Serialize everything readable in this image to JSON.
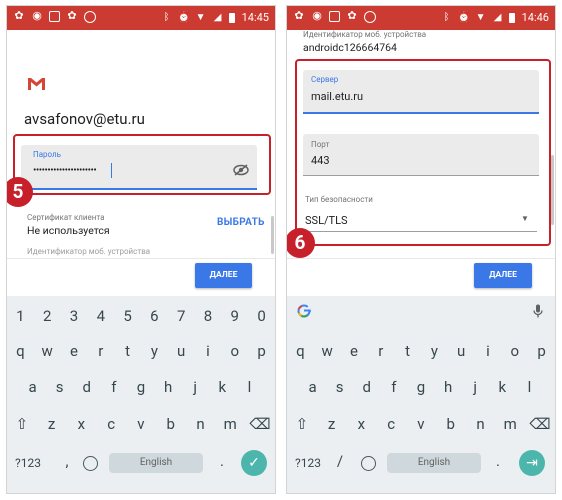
{
  "status_bar": {
    "time": "14:45"
  },
  "left_screen": {
    "account_email": "avsafonov@etu.ru",
    "password_field": {
      "label": "Пароль",
      "value": "••••••••••••••••••••••"
    },
    "client_certificate": {
      "label": "Сертификат клиента",
      "value": "Не используется",
      "action": "ВЫБРАТЬ"
    },
    "device_id_label_partial": "Идентификатор моб. устройства",
    "next_button": "ДАЛЕЕ",
    "step_badge": "5"
  },
  "right_screen": {
    "status_time": "14:46",
    "device_id": {
      "label": "Идентификатор моб. устройства",
      "value": "androidc126664764"
    },
    "server_field": {
      "label": "Сервер",
      "value": "mail.etu.ru"
    },
    "port_field": {
      "label": "Порт",
      "value": "443"
    },
    "security_field": {
      "label": "Тип безопасности",
      "value": "SSL/TLS"
    },
    "next_button": "ДАЛЕЕ",
    "step_badge": "6"
  },
  "keyboard": {
    "number_row": [
      "1",
      "2",
      "3",
      "4",
      "5",
      "6",
      "7",
      "8",
      "9",
      "0"
    ],
    "row1": [
      "q",
      "w",
      "e",
      "r",
      "t",
      "y",
      "u",
      "i",
      "o",
      "p"
    ],
    "row2": [
      "a",
      "s",
      "d",
      "f",
      "g",
      "h",
      "j",
      "k",
      "l"
    ],
    "row3": [
      "z",
      "x",
      "c",
      "v",
      "b",
      "n",
      "m"
    ],
    "symbols_key": "?123",
    "comma_key": ",",
    "slash_key": "/",
    "period_key": ".",
    "space_label": "English"
  },
  "colors": {
    "status_bar": "#cc3b32",
    "highlight": "#c8202a",
    "accent": "#3b78e7",
    "enter_key": "#4db6ac"
  }
}
